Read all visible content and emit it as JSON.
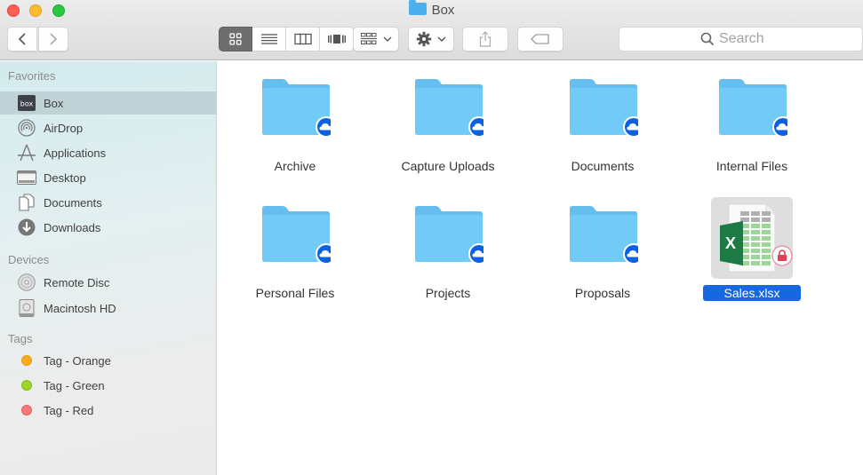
{
  "window": {
    "title": "Box",
    "traffic_lights": [
      "close",
      "minimize",
      "maximize"
    ]
  },
  "toolbar": {
    "back_icon": "chevron-left-icon",
    "forward_icon": "chevron-right-icon",
    "view_modes": [
      {
        "name": "icon-view",
        "icon": "grid-icon",
        "selected": true
      },
      {
        "name": "list-view",
        "icon": "list-icon",
        "selected": false
      },
      {
        "name": "column-view",
        "icon": "columns-icon",
        "selected": false
      },
      {
        "name": "cover-flow-view",
        "icon": "cover-flow-icon",
        "selected": false
      }
    ],
    "arrange_icon": "arrange-grid-icon",
    "action_icon": "gear-icon",
    "share_icon": "share-icon",
    "tag_icon": "tag-icon",
    "search_placeholder": "Search"
  },
  "sidebar": {
    "favorites_label": "Favorites",
    "favorites": [
      {
        "label": "Box",
        "icon": "box-logo-icon",
        "selected": true
      },
      {
        "label": "AirDrop",
        "icon": "airdrop-icon"
      },
      {
        "label": "Applications",
        "icon": "applications-icon"
      },
      {
        "label": "Desktop",
        "icon": "desktop-icon"
      },
      {
        "label": "Documents",
        "icon": "documents-icon"
      },
      {
        "label": "Downloads",
        "icon": "downloads-icon"
      }
    ],
    "devices_label": "Devices",
    "devices": [
      {
        "label": "Remote Disc",
        "icon": "disc-icon"
      },
      {
        "label": "Macintosh HD",
        "icon": "hard-drive-icon"
      }
    ],
    "tags_label": "Tags",
    "tags": [
      {
        "label": "Tag - Orange",
        "color": "#f9ad1a"
      },
      {
        "label": "Tag - Green",
        "color": "#9ad424"
      },
      {
        "label": "Tag - Red",
        "color": "#f37a7a"
      }
    ]
  },
  "files": [
    {
      "name": "Archive",
      "type": "folder",
      "badge": "cloud-icon"
    },
    {
      "name": "Capture Uploads",
      "type": "folder",
      "badge": "cloud-icon"
    },
    {
      "name": "Documents",
      "type": "folder",
      "badge": "cloud-icon"
    },
    {
      "name": "Internal Files",
      "type": "folder",
      "badge": "cloud-icon"
    },
    {
      "name": "Personal Files",
      "type": "folder",
      "badge": "cloud-icon"
    },
    {
      "name": "Projects",
      "type": "folder",
      "badge": "cloud-icon"
    },
    {
      "name": "Proposals",
      "type": "folder",
      "badge": "cloud-icon"
    },
    {
      "name": "Sales.xlsx",
      "type": "excel",
      "badge": "lock-icon",
      "selected": true
    }
  ],
  "colors": {
    "folder": "#6cc7f5",
    "cloud_badge": "#0b62e0",
    "selection": "#1768e0",
    "excel_green": "#1d7a45",
    "lock_badge": "#e23f55"
  }
}
